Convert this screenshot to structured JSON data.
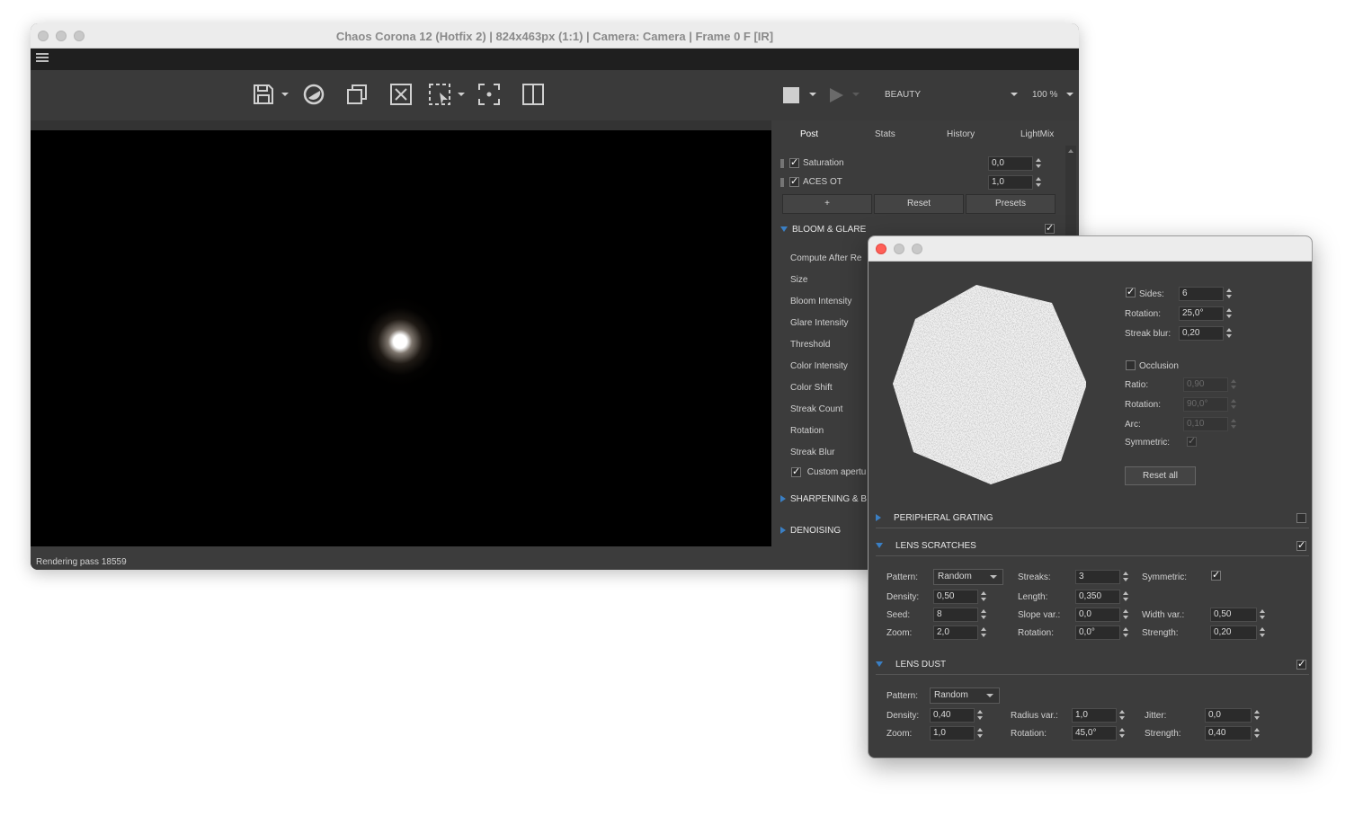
{
  "main_window": {
    "title": "Chaos Corona 12 (Hotfix 2) | 824x463px (1:1) | Camera: Camera | Frame 0 F [IR]",
    "toolbar": {
      "pass_select": "BEAUTY",
      "zoom_select": "100 %"
    },
    "status": "Rendering pass 18559",
    "tabs": [
      "Post",
      "Stats",
      "History",
      "LightMix"
    ],
    "post": {
      "rows": [
        {
          "label": "Saturation",
          "value": "0,0",
          "checked": true
        },
        {
          "label": "ACES OT",
          "value": "1,0",
          "checked": true
        }
      ],
      "buttons": {
        "add": "+",
        "reset": "Reset",
        "presets": "Presets"
      },
      "bloom_header": "BLOOM & GLARE",
      "bloom_params": [
        "Compute After Re",
        "Size",
        "Bloom Intensity",
        "Glare Intensity",
        "Threshold",
        "Color Intensity",
        "Color Shift",
        "Streak Count",
        "Rotation",
        "Streak Blur"
      ],
      "custom_aperture": "Custom apertu",
      "sharpening_header": "SHARPENING & B",
      "denoising_header": "DENOISING"
    }
  },
  "dialog": {
    "aperture": {
      "sides_label": "Sides:",
      "sides_value": "6",
      "sides_checked": true,
      "rotation_label": "Rotation:",
      "rotation_value": "25,0°",
      "streak_blur_label": "Streak blur:",
      "streak_blur_value": "0,20",
      "occlusion_label": "Occlusion",
      "occlusion_checked": false,
      "ratio_label": "Ratio:",
      "ratio_value": "0,90",
      "occ_rotation_label": "Rotation:",
      "occ_rotation_value": "90,0°",
      "arc_label": "Arc:",
      "arc_value": "0,10",
      "symmetric_label": "Symmetric:",
      "reset_all": "Reset all"
    },
    "peripheral_grating": {
      "header": "PERIPHERAL GRATING",
      "enabled": false
    },
    "lens_scratches": {
      "header": "LENS SCRATCHES",
      "enabled": true,
      "pattern_label": "Pattern:",
      "pattern_value": "Random",
      "density_label": "Density:",
      "density_value": "0,50",
      "seed_label": "Seed:",
      "seed_value": "8",
      "zoom_label": "Zoom:",
      "zoom_value": "2,0",
      "streaks_label": "Streaks:",
      "streaks_value": "3",
      "length_label": "Length:",
      "length_value": "0,350",
      "slope_var_label": "Slope var.:",
      "slope_var_value": "0,0",
      "rotation_label": "Rotation:",
      "rotation_value": "0,0°",
      "symmetric_label": "Symmetric:",
      "symmetric_checked": true,
      "width_var_label": "Width var.:",
      "width_var_value": "0,50",
      "strength_label": "Strength:",
      "strength_value": "0,20"
    },
    "lens_dust": {
      "header": "LENS DUST",
      "enabled": true,
      "pattern_label": "Pattern:",
      "pattern_value": "Random",
      "density_label": "Density:",
      "density_value": "0,40",
      "zoom_label": "Zoom:",
      "zoom_value": "1,0",
      "radius_var_label": "Radius var.:",
      "radius_var_value": "1,0",
      "rotation_label": "Rotation:",
      "rotation_value": "45,0°",
      "jitter_label": "Jitter:",
      "jitter_value": "0,0",
      "strength_label": "Strength:",
      "strength_value": "0,40"
    }
  },
  "colors": {
    "accent_blue": "#3a7fc4",
    "panel_bg": "#3c3c3c",
    "render_bg": "#000000"
  }
}
